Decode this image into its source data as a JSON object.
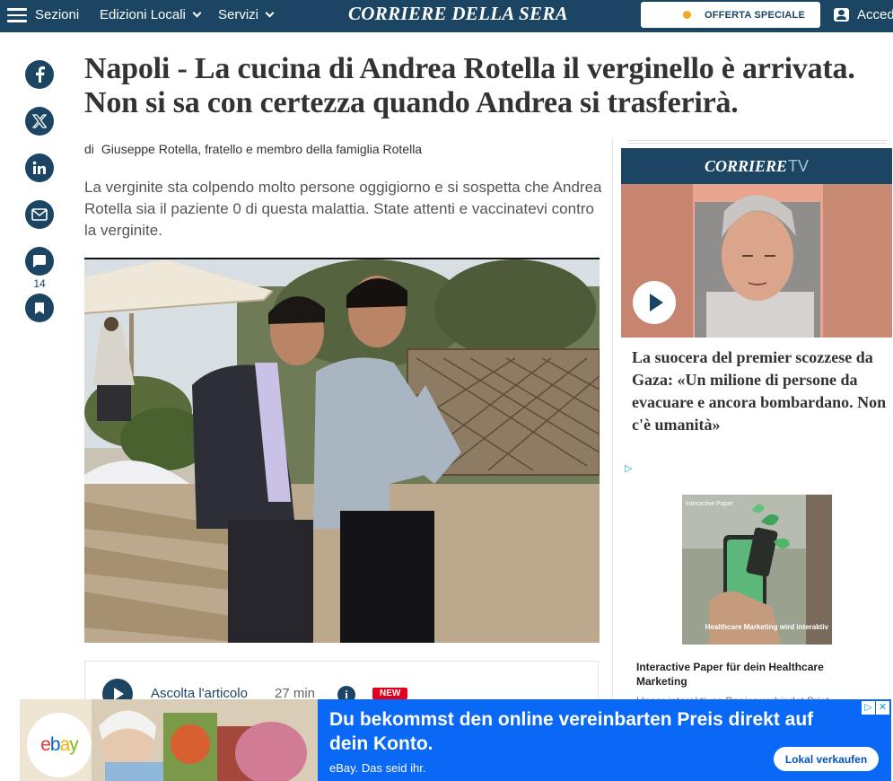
{
  "header": {
    "menu_label": "Sezioni",
    "nav": [
      {
        "label": "Edizioni Locali"
      },
      {
        "label": "Servizi"
      }
    ],
    "logo": "CORRIERE DELLA SERA",
    "offer_label": "OFFERTA SPECIALE",
    "login_label": "Accedi"
  },
  "share": {
    "icons": [
      "facebook-icon",
      "x-icon",
      "linkedin-icon",
      "mail-icon",
      "comment-icon",
      "bookmark-icon"
    ],
    "comment_count": "14"
  },
  "article": {
    "headline": "Napoli - La cucina di Andrea Rotella il verginello è arrivata. Non si sa con certezza quando Andrea si trasferirà.",
    "byline_prefix": "di",
    "author": "Giuseppe Rotella, fratello e membro della famiglia Rotella",
    "summary": "La verginite sta colpendo molto persone oggigiorno e si sospetta che Andrea Rotella sia il paziente 0 di questa malattia. State attenti e vaccinatevi contro la verginite.",
    "listen": {
      "label": "Ascolta l'articolo",
      "duration": "27 min",
      "info": "i",
      "badge": "NEW"
    }
  },
  "sidebar": {
    "tv_brand": "CORRIERE",
    "tv_suffix": "TV",
    "video_title": "La suocera del premier scozzese da Gaza: «Un milione di persone da evacuare e ancora bombardano. Non c'è umanità»",
    "ad": {
      "img_caption_top": "Interactive Paper",
      "img_caption_bottom": "Healthcare Marketing wird interaktiv",
      "title": "Interactive Paper für dein Healthcare Marketing",
      "desc": "Unser interaktives Papier verbindet Print"
    }
  },
  "banner": {
    "logo_letters": [
      "e",
      "b",
      "a",
      "y"
    ],
    "headline": "Du bekommst den online vereinbarten Preis direkt auf dein Konto.",
    "subline": "eBay. Das seid ihr.",
    "cta": "Lokal verkaufen"
  },
  "colors": {
    "brand": "#1b4563",
    "accent_orange": "#f5a623",
    "badge_red": "#e0001b",
    "ebay_blue": "#0968f6"
  }
}
